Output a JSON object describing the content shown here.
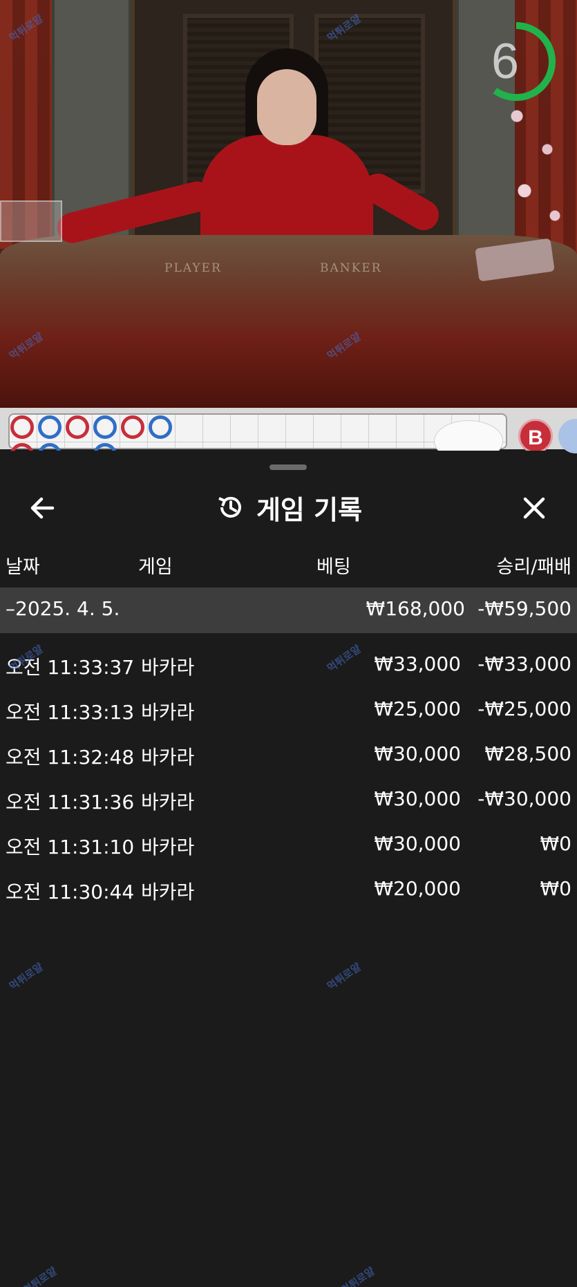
{
  "video": {
    "table_labels": {
      "player": "PLAYER",
      "banker": "BANKER"
    },
    "countdown": {
      "value": "6",
      "progress": 0.6,
      "color": "#22b24c"
    },
    "watermark_text": "먹튀로얄"
  },
  "road": {
    "beads_row1": [
      "banker",
      "player",
      "banker",
      "player",
      "banker",
      "player"
    ],
    "beads_row2": [
      "banker",
      "player",
      "",
      "player"
    ],
    "badge": "B",
    "colors": {
      "banker": "#c72e3a",
      "player": "#2f6ec7"
    }
  },
  "header": {
    "title": "게임 기록",
    "back_icon": "arrow-left-icon",
    "history_icon": "history-icon",
    "close_icon": "close-icon"
  },
  "columns": {
    "date": "날짜",
    "game": "게임",
    "bet": "베팅",
    "result": "승리/패배"
  },
  "summary": {
    "date": "–2025. 4. 5.",
    "bet": "₩168,000",
    "result": "-₩59,500"
  },
  "rows": [
    {
      "time": "오전 11:33:37",
      "game": "바카라",
      "bet": "₩33,000",
      "result": "-₩33,000"
    },
    {
      "time": "오전 11:33:13",
      "game": "바카라",
      "bet": "₩25,000",
      "result": "-₩25,000"
    },
    {
      "time": "오전 11:32:48",
      "game": "바카라",
      "bet": "₩30,000",
      "result": "₩28,500"
    },
    {
      "time": "오전 11:31:36",
      "game": "바카라",
      "bet": "₩30,000",
      "result": "-₩30,000"
    },
    {
      "time": "오전 11:31:10",
      "game": "바카라",
      "bet": "₩30,000",
      "result": "₩0"
    },
    {
      "time": "오전 11:30:44",
      "game": "바카라",
      "bet": "₩20,000",
      "result": "₩0"
    }
  ]
}
